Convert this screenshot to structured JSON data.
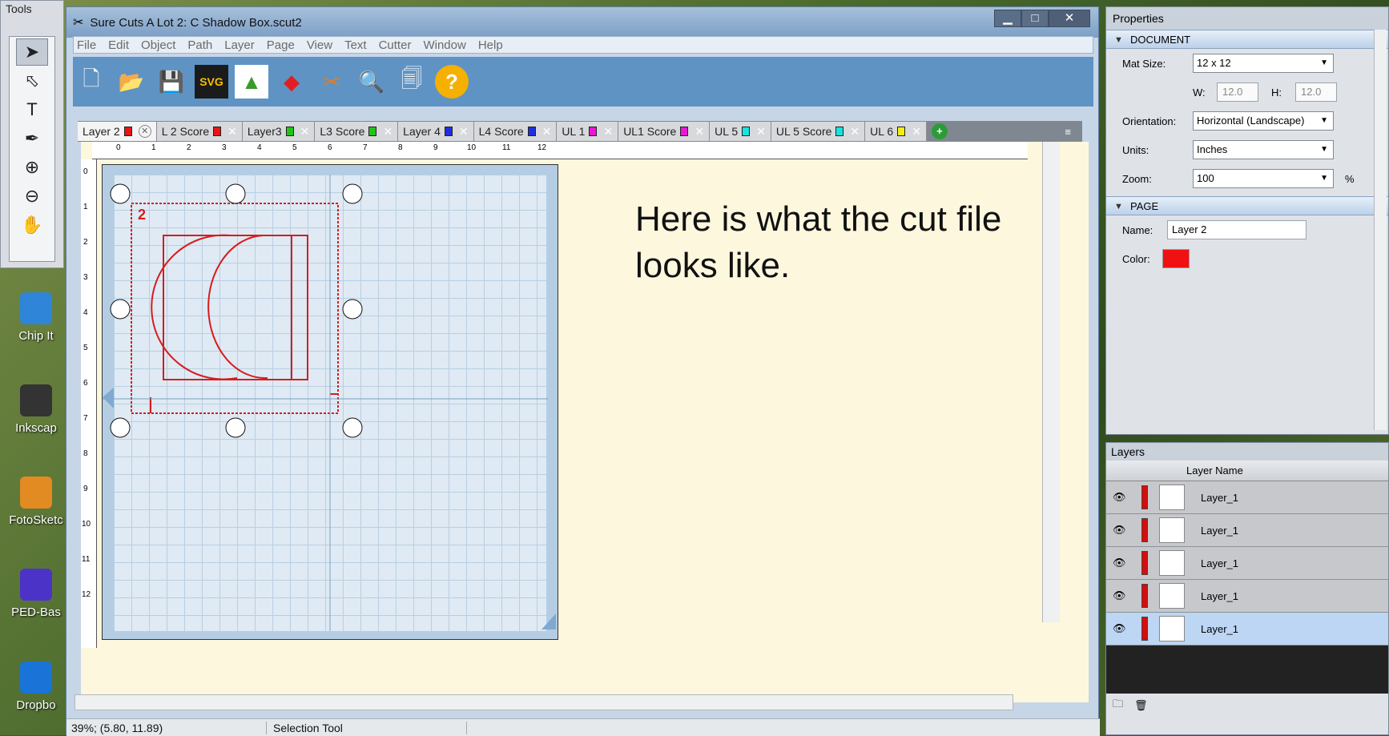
{
  "tools_panel": {
    "title": "Tools"
  },
  "desktop_icons": [
    {
      "label": "Chip It"
    },
    {
      "label": "Inkscap"
    },
    {
      "label": "FotoSketc"
    },
    {
      "label": "PED-Bas"
    },
    {
      "label": "Dropbo"
    }
  ],
  "window": {
    "title": "Sure Cuts A Lot 2: C Shadow Box.scut2",
    "buttons": {
      "minimize": "▁",
      "maximize": "□",
      "close": "✕"
    }
  },
  "menu": [
    "File",
    "Edit",
    "Object",
    "Path",
    "Layer",
    "Page",
    "View",
    "Text",
    "Cutter",
    "Window",
    "Help"
  ],
  "toolbar_icons": [
    "new-document-icon",
    "open-file-icon",
    "save-icon",
    "import-svg-icon",
    "add-image-icon",
    "add-shapes-icon",
    "cut-icon",
    "preview-icon",
    "page-preview-icon",
    "help-icon"
  ],
  "tabs": [
    {
      "label": "Layer 2",
      "color": "#e81515",
      "active": true
    },
    {
      "label": "L 2 Score",
      "color": "#e81515"
    },
    {
      "label": "Layer3",
      "color": "#22c41a"
    },
    {
      "label": "L3 Score",
      "color": "#22c41a"
    },
    {
      "label": "Layer 4",
      "color": "#1f2fe0"
    },
    {
      "label": "L4 Score",
      "color": "#1f2fe0"
    },
    {
      "label": "UL 1",
      "color": "#e818d5"
    },
    {
      "label": "UL1 Score",
      "color": "#e818d5"
    },
    {
      "label": "UL 5",
      "color": "#19e3e0"
    },
    {
      "label": "UL 5 Score",
      "color": "#19e3e0"
    },
    {
      "label": "UL 6",
      "color": "#f2ee1a"
    }
  ],
  "ruler": {
    "h_ticks": [
      "0",
      "1",
      "2",
      "3",
      "4",
      "5",
      "6",
      "7",
      "8",
      "9",
      "10",
      "11",
      "12"
    ],
    "v_ticks": [
      "0",
      "1",
      "2",
      "3",
      "4",
      "5",
      "6",
      "7",
      "8",
      "9",
      "10",
      "11",
      "12"
    ]
  },
  "canvas": {
    "note": "Here is what the cut file looks like.",
    "mat_label": "2"
  },
  "status": {
    "coords": "39%; (5.80, 11.89)",
    "tool": "Selection Tool"
  },
  "properties": {
    "title": "Properties",
    "document_section": "DOCUMENT",
    "mat_size_label": "Mat Size:",
    "mat_size": "12 x 12",
    "w_label": "W:",
    "w": "12.0",
    "h_label": "H:",
    "h": "12.0",
    "orientation_label": "Orientation:",
    "orientation": "Horizontal (Landscape)",
    "units_label": "Units:",
    "units": "Inches",
    "zoom_label": "Zoom:",
    "zoom": "100",
    "zoom_unit": "%",
    "page_section": "PAGE",
    "name_label": "Name:",
    "name": "Layer 2",
    "color_label": "Color:",
    "color": "#f01212"
  },
  "layers": {
    "title": "Layers",
    "col_header": "Layer Name",
    "rows": [
      {
        "name": "Layer_1",
        "selected": false
      },
      {
        "name": "Layer_1",
        "selected": false
      },
      {
        "name": "Layer_1",
        "selected": false
      },
      {
        "name": "Layer_1",
        "selected": false
      },
      {
        "name": "Layer_1",
        "selected": true
      }
    ]
  }
}
